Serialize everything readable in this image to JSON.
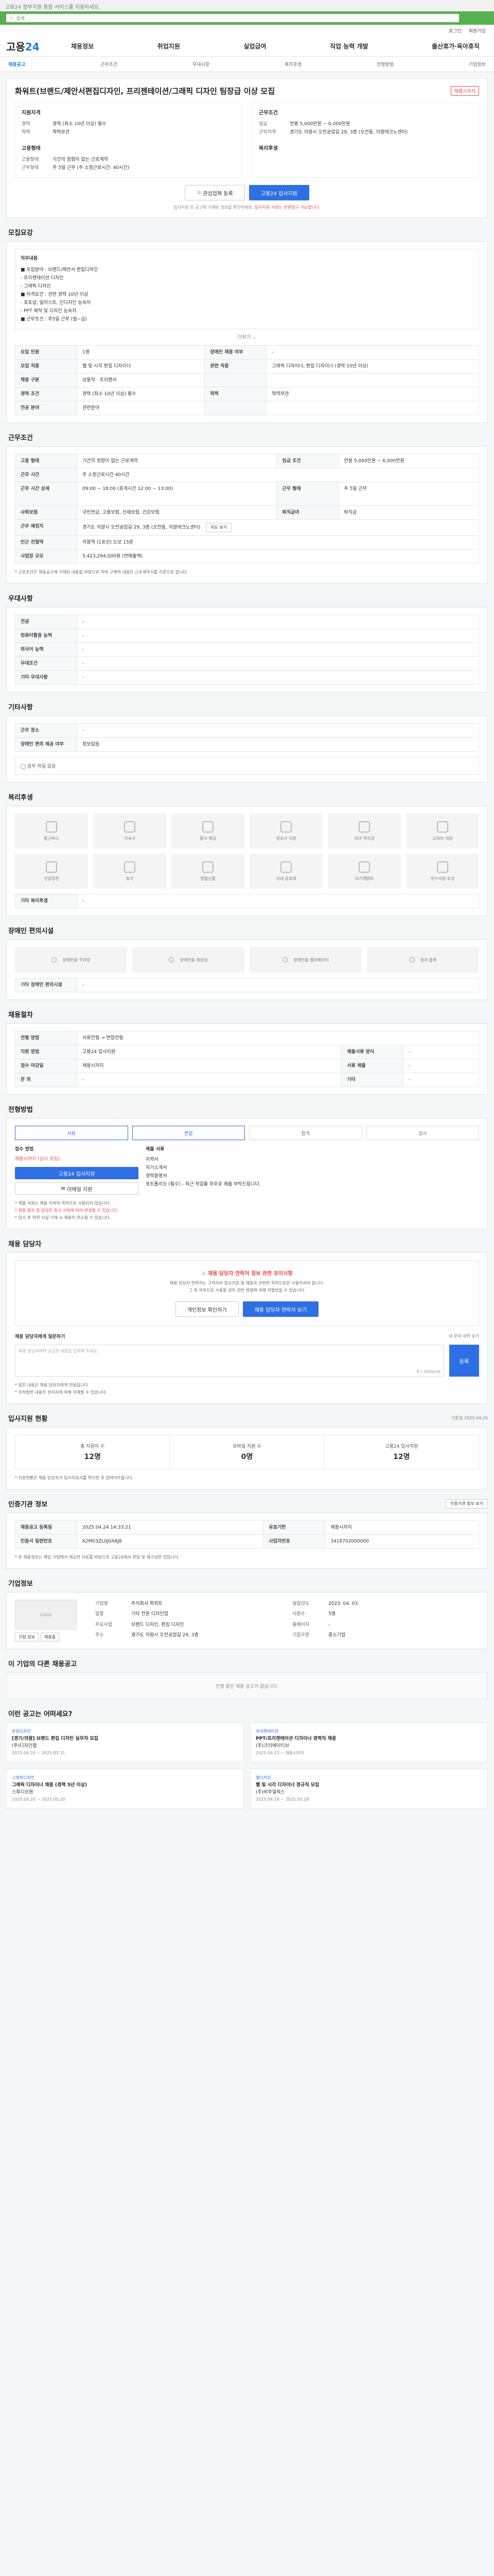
{
  "top_notice": "고용24 정부지원 통합 서비스를 이용하세요.",
  "search": {
    "placeholder": "검색"
  },
  "util": [
    "로그인",
    "회원가입"
  ],
  "brand": {
    "name_prefix": "고용",
    "name_suffix": "24"
  },
  "gnb": [
    "채용정보",
    "취업지원",
    "실업급여",
    "직업 능력 개발",
    "출산휴가·육아휴직"
  ],
  "tabs": [
    {
      "label": "채용공고",
      "on": true
    },
    {
      "label": "근무조건",
      "on": false
    },
    {
      "label": "우대사항",
      "on": false
    },
    {
      "label": "복리후생",
      "on": false
    },
    {
      "label": "전형방법",
      "on": false
    },
    {
      "label": "기업정보",
      "on": false
    }
  ],
  "job": {
    "badge": "채용시까지",
    "title": "화워트(브랜드/제안서편집디자인, 프리젠테이션/그래픽 디자인 팀장급 이상 모집",
    "left_h": "지원자격",
    "right_h": "근무조건",
    "left_kv": [
      {
        "k": "경력",
        "v": "경력 (최소 10년 이상) 필수"
      },
      {
        "k": "학력",
        "v": "학력무관"
      }
    ],
    "left_kv2_h": "고용형태",
    "left_kv2": [
      {
        "k": "고용형태",
        "v": "기간의 정함이 없는 근로계약"
      },
      {
        "k": "근무형태",
        "v": "주 5일 근무 (주 소정근로시간: 40시간)"
      }
    ],
    "right_kv": [
      {
        "k": "임금",
        "v": "연봉 5,000만원 ~ 6,000만원"
      },
      {
        "k": "근무지역",
        "v": "경기도 의왕시 오전공업길 29, 3층 (오전동, 의왕테크노센터)"
      }
    ],
    "right_kv2_h": "복리후생",
    "btn_scrap": "관심업체 등록",
    "btn_apply": "고용24 입사지원",
    "note_prefix": "입사지원 전 공고에 기재된 정보를 확인하세요.",
    "note_red": "입사지원 서류는 반환청구 가능합니다."
  },
  "recruit": {
    "title": "모집요강",
    "duty_h": "직무내용",
    "duty_lines": [
      "■ 모집분야 : 브랜드/제안서 편집디자인",
      "    - 프리젠테이션 디자인",
      "    - 그래픽 디자인",
      "■ 자격요건 : 관련 경력 10년 이상",
      "    - 포토샵, 일러스트, 인디자인 능숙자",
      "    - PPT 제작 및 디자인 능숙자",
      "■ 근무조건 : 주5일 근무 (월~금)"
    ],
    "more": "더보기",
    "rows": [
      {
        "h1": "모집 인원",
        "v1": "1명",
        "h2": "장애인 채용 여부",
        "v2": "-"
      },
      {
        "h1": "모집 직종",
        "v1": "웹 및 시각 편집 디자이너",
        "h2": "관련 직종",
        "v2": "그래픽 디자이너, 편집 디자이너 (경력 10년 이상)"
      },
      {
        "h1": "채용 구분",
        "v1": "상용직 · 프리랜서",
        "h2": "",
        "v2": ""
      },
      {
        "h1": "경력 조건",
        "v1": "경력 (최소 10년 이상) 필수",
        "h2": "학력",
        "v2": "학력무관"
      },
      {
        "h1": "전공 분야",
        "v1": "관련분야",
        "h2": "",
        "v2": ""
      }
    ]
  },
  "condition": {
    "title": "근무조건",
    "rows": [
      {
        "h1": "고용 형태",
        "v1": "기간의 정함이 없는 근로계약",
        "h2": "임금 조건",
        "v2": "연봉 5,000만원 ~ 6,000만원"
      },
      {
        "h1": "근무 시간",
        "v1": "주 소정근로시간 40시간",
        "h2": "",
        "v2": ""
      },
      {
        "h1": "근무 시간 상세",
        "v1": "09:00 ~ 18:00 (휴게시간 12:00 ~ 13:00)",
        "h2": "근무 형태",
        "v2": "주 5일 근무"
      },
      {
        "h1": "사회보험",
        "v1": "국민연금, 고용보험, 산재보험, 건강보험",
        "h2": "퇴직급여",
        "v2": "퇴직금"
      },
      {
        "h1": "근무 예정지",
        "v1": "경기도 의왕시 오전공업길 29, 3층 (오전동, 의왕테크노센터)",
        "h2": "",
        "v2": ""
      },
      {
        "h1": "인근 전철역",
        "v1": "의왕역 (1호선) 도보 15분",
        "h2": "",
        "v2": ""
      },
      {
        "h1": "사업장 규모",
        "v1": "5,423,294,000원 (연매출액)",
        "h2": "",
        "v2": ""
      }
    ],
    "btn_map": "지도 보기",
    "footnote": "* 근로조건은 채용공고에 기재된 내용을 바탕으로 하며 구체적 내용은 근로계약서를 기준으로 합니다."
  },
  "preference": {
    "title": "우대사항",
    "rows": [
      {
        "h": "전공",
        "v": "-"
      },
      {
        "h": "컴퓨터활용 능력",
        "v": "-"
      },
      {
        "h": "외국어 능력",
        "v": "-"
      },
      {
        "h": "우대조건",
        "v": "-"
      },
      {
        "h": "기타 우대사항",
        "v": "-"
      }
    ]
  },
  "other": {
    "title": "기타사항",
    "rows": [
      {
        "h": "근무 장소",
        "v": "-"
      },
      {
        "h": "장애인 편의 제공 여부",
        "v": "정보없음"
      }
    ],
    "attach": "첨부 파일 없음"
  },
  "welfare": {
    "title": "복리후생",
    "items": [
      "통근버스",
      "기숙사",
      "중식 제공",
      "경조사 지원",
      "자녀 학자금",
      "교육비 지원",
      "건강검진",
      "휴가",
      "명절선물",
      "사내 동호회",
      "자기계발비",
      "우수사원 포상"
    ],
    "etc_h": "기타 복리후생",
    "etc_v": "-"
  },
  "disability": {
    "title": "장애인 편의시설",
    "items": [
      "장애인용 주차장",
      "장애인용 화장실",
      "장애인용 엘리베이터",
      "점자 블록"
    ],
    "etc_h": "기타 장애인 편의시설",
    "etc_v": "-"
  },
  "selection": {
    "title": "채용절차",
    "rows": [
      {
        "h1": "전형 방법",
        "v1": "서류전형 → 면접전형",
        "h2": "",
        "v2": ""
      },
      {
        "h1": "지원 방법",
        "v1": "고용24 입사지원",
        "h2": "제출서류 양식",
        "v2": "-"
      },
      {
        "h1": "접수 마감일",
        "v1": "채용시까지",
        "h2": "서류 제출",
        "v2": "-"
      },
      {
        "h1": "문 의",
        "v1": "-",
        "h2": "기타",
        "v2": "-"
      }
    ]
  },
  "process": {
    "title": "전형방법",
    "steps": [
      "서류",
      "면접",
      "합격",
      "입사"
    ],
    "apply_h": "접수 방법",
    "apply_v": "채용시까지 (상시 모집)",
    "apply_btn": "고용24 입사지원",
    "email_btn": "이메일 지원",
    "docs_h": "제출 서류",
    "docs_lines": [
      "이력서",
      "자기소개서",
      "경력증명서",
      "포트폴리오 (필수) - 최근 작업물 위주로 제출 부탁드립니다."
    ],
    "notes": [
      "* 제출 서류는 채용 이외의 목적으로 사용되지 않습니다.",
      "* 채용 절차 및 일정은 회사 사정에 따라 변경될 수 있습니다.",
      "* 입사 후 허위 사실 기재 시 채용이 취소될 수 있습니다."
    ]
  },
  "contact": {
    "title": "채용 담당자",
    "warn": "채용 담당자 연락처 정보 관련 유의사항",
    "lines": [
      "채용 담당자 연락처는 구직자의 입사지원 및 채용과 관련한 목적으로만 사용하셔야 합니다.",
      "그 외 목적으로 사용할 경우 관련 법령에 의해 처벌받을 수 있습니다."
    ],
    "btn_check": "개인정보 확인하기",
    "btn_view": "채용 담당자 연락처 보기",
    "qa_h": "채용 담당자에게 질문하기",
    "qa_link": "내 문의 내역 보기",
    "qa_placeholder": "채용 담당자에게 궁금한 내용을 입력해 주세요.",
    "qa_count": "0 / 500byte",
    "qa_btn": "등록",
    "qa_notes": [
      "* 질문 내용은 채용 담당자에게 전달됩니다.",
      "* 부적절한 내용은 관리자에 의해 삭제될 수 있습니다."
    ]
  },
  "stats": {
    "title": "입사지원 현황",
    "period": "기준일 2025.04.24",
    "items": [
      {
        "label": "총 지원자 수",
        "num": "12명"
      },
      {
        "label": "모바일 지원 수",
        "num": "0명"
      },
      {
        "label": "고용24 입사지원",
        "num": "12명"
      }
    ],
    "note": "* 지원현황은 채용 담당자가 입사지원서를 확인한 후 업데이트됩니다."
  },
  "info": {
    "title": "인증기관 정보",
    "link": "인증기관 정보 보기",
    "rows": [
      {
        "h1": "채용공고 등록일",
        "v1": "2025.04.24 14:33:21",
        "h2": "유효기한",
        "v2": "채용시까지"
      },
      {
        "h1": "인증서 일련번호",
        "v1": "K2M03ZL0J0A8J8",
        "h2": "사업자번호",
        "v2": "3418702000000"
      }
    ],
    "footnote": "* 본 채용정보는 해당 기업에서 제공한 자료를 바탕으로 고용24에서 편집 및 재구성한 것입니다."
  },
  "company": {
    "title": "기업정보",
    "logo_txt": "LOGO",
    "btn_a": "기업 정보",
    "btn_b": "채용중",
    "info": [
      {
        "k": "기업명",
        "v": "주식회사 화워트"
      },
      {
        "k": "설립년도",
        "v": "2023. 04. 03"
      },
      {
        "k": "업종",
        "v": "기타 전문 디자인업"
      },
      {
        "k": "사원수",
        "v": "5명"
      },
      {
        "k": "주요사업",
        "v": "브랜드 디자인, 편집 디자인"
      },
      {
        "k": "홈페이지",
        "v": "-"
      },
      {
        "k": "주소",
        "v": "경기도 의왕시 오전공업길 29, 3층"
      },
      {
        "k": "기업구분",
        "v": "중소기업"
      }
    ]
  },
  "others": {
    "title": "이 기업의 다른 채용공고",
    "empty": "진행 중인 채용 공고가 없습니다."
  },
  "recommend": {
    "title": "이런 공고는 어떠세요?",
    "items": [
      {
        "tag": "편집디자인",
        "title": "[경기/의왕] 브랜드 편집 디자인 실무자 모집",
        "company": "(주)디자인랩",
        "date": "2025.04.24 ~ 2025.05.31"
      },
      {
        "tag": "프리젠테이션",
        "title": "PPT/프리젠테이션 디자이너 경력직 채용",
        "company": "(주)크리에이티브",
        "date": "2025.04.22 ~ 채용시까지"
      },
      {
        "tag": "그래픽디자인",
        "title": "그래픽 디자이너 채용 (경력 5년 이상)",
        "company": "스튜디오원",
        "date": "2025.04.20 ~ 2025.05.20"
      },
      {
        "tag": "웹디자인",
        "title": "웹 및 시각 디자이너 정규직 모집",
        "company": "(주)비주얼웍스",
        "date": "2025.04.18 ~ 2025.05.18"
      }
    ]
  }
}
